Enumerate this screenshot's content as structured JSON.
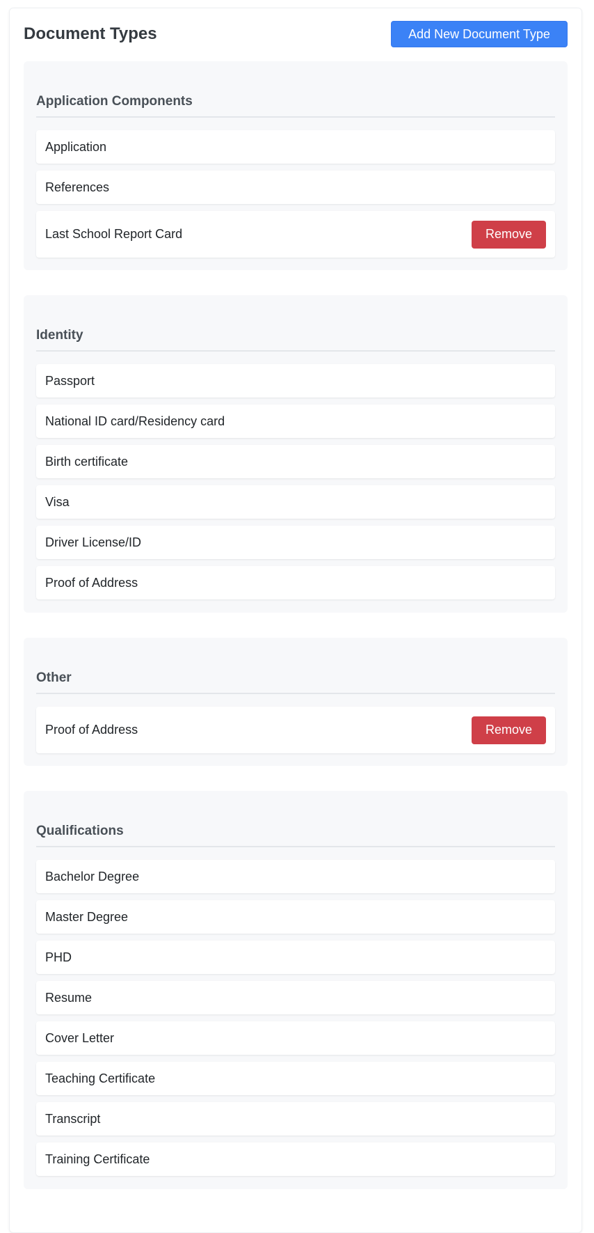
{
  "header": {
    "title": "Document Types",
    "add_button_label": "Add New Document Type"
  },
  "sections": [
    {
      "title": "Application Components",
      "items": [
        {
          "label": "Application"
        },
        {
          "label": "References"
        },
        {
          "label": "Last School Report Card",
          "remove_label": "Remove"
        }
      ]
    },
    {
      "title": "Identity",
      "items": [
        {
          "label": "Passport"
        },
        {
          "label": "National ID card/Residency card"
        },
        {
          "label": "Birth certificate"
        },
        {
          "label": "Visa"
        },
        {
          "label": "Driver License/ID"
        },
        {
          "label": "Proof of Address"
        }
      ]
    },
    {
      "title": "Other",
      "items": [
        {
          "label": "Proof of Address",
          "remove_label": "Remove"
        }
      ]
    },
    {
      "title": "Qualifications",
      "items": [
        {
          "label": "Bachelor Degree"
        },
        {
          "label": "Master Degree"
        },
        {
          "label": "PHD"
        },
        {
          "label": "Resume"
        },
        {
          "label": "Cover Letter"
        },
        {
          "label": "Teaching Certificate"
        },
        {
          "label": "Transcript"
        },
        {
          "label": "Training Certificate"
        }
      ]
    }
  ]
}
